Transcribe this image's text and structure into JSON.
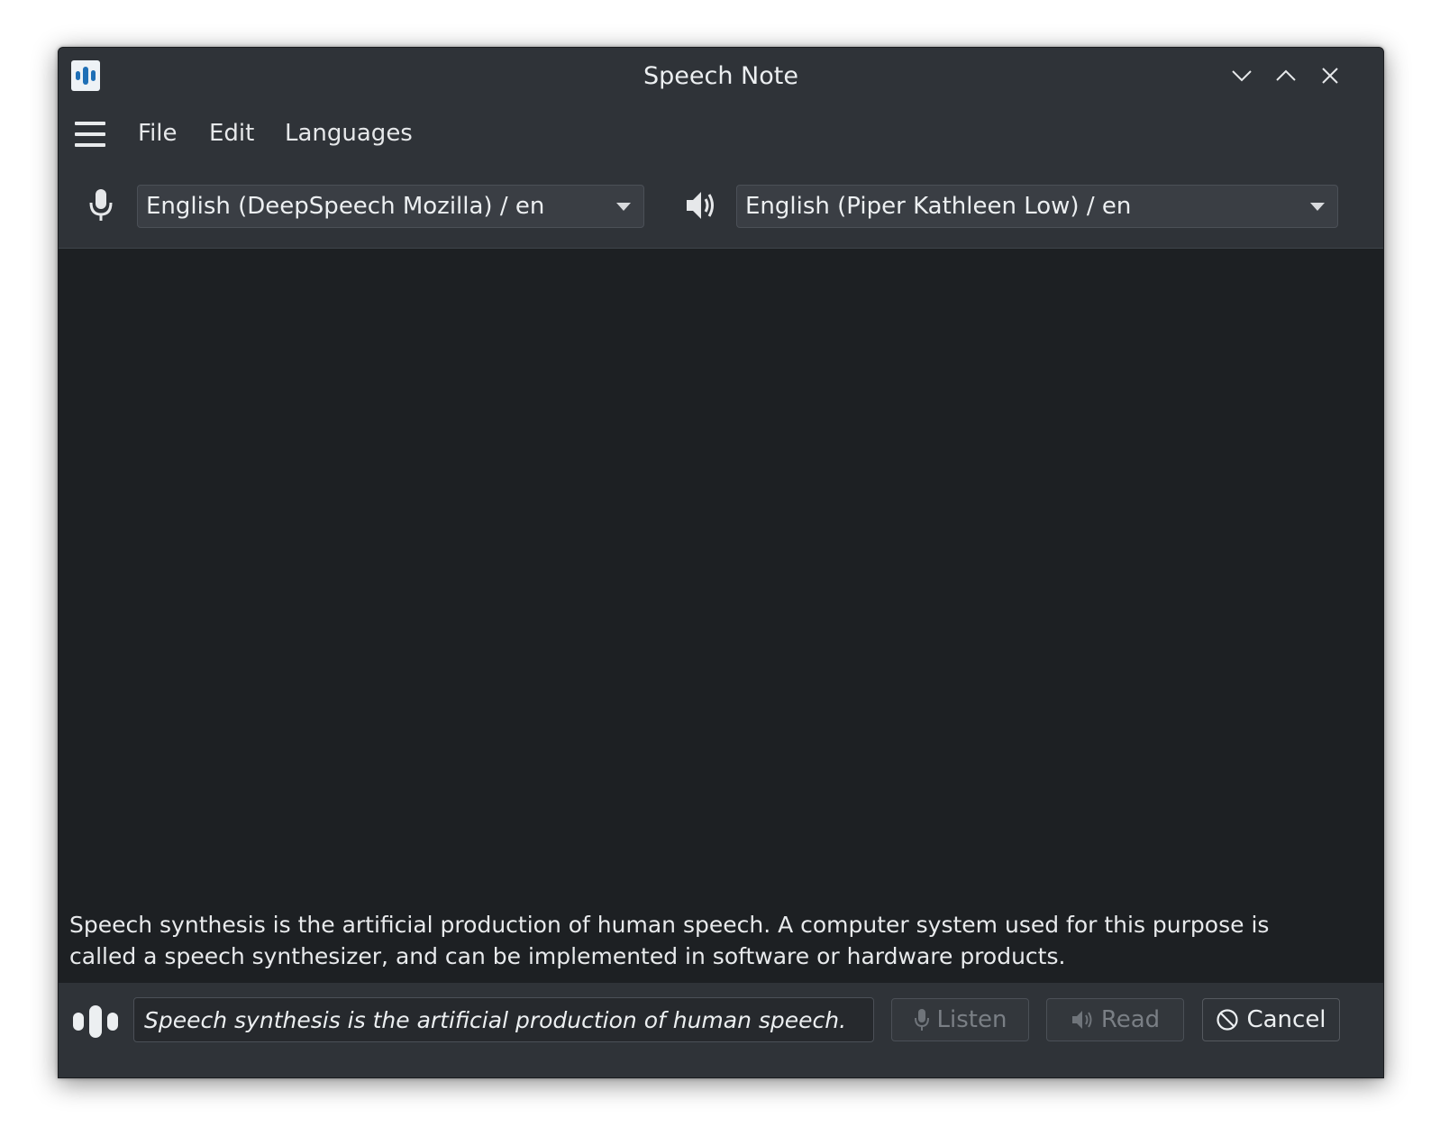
{
  "window": {
    "title": "Speech Note"
  },
  "menu": {
    "items": [
      "File",
      "Edit",
      "Languages"
    ]
  },
  "languages": {
    "stt_model": "English (DeepSpeech Mozilla) / en",
    "tts_model": "English (Piper Kathleen Low) / en"
  },
  "notes": {
    "text": "Speech synthesis is the artificial production of human speech. A computer system used for this purpose is called a speech synthesizer, and can be implemented in software or hardware products."
  },
  "bottom": {
    "current_sentence": "Speech synthesis is the artificial production of human speech.",
    "listen_label": "Listen",
    "read_label": "Read",
    "cancel_label": "Cancel"
  },
  "icons": {
    "app": "speech-note-app-icon",
    "menu": "hamburger-menu-icon",
    "microphone": "microphone-icon",
    "speaker": "speaker-icon",
    "status": "speech-activity-icon",
    "cancel": "cancel-circle-icon",
    "minimize": "chevron-down-icon",
    "maximize": "chevron-up-icon",
    "close": "close-icon"
  },
  "colors": {
    "window_bg": "#2f3338",
    "text_area_bg": "#1d2023",
    "app_icon_accent": "#1f6fb6"
  }
}
